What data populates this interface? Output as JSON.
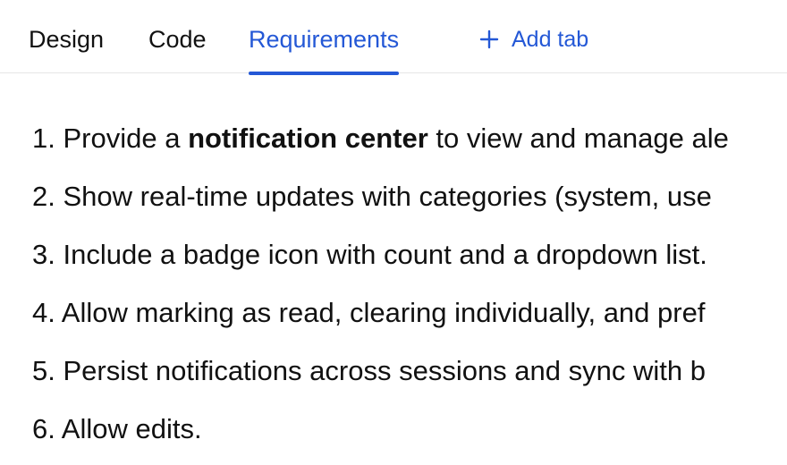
{
  "tabs": [
    {
      "label": "Design",
      "active": false
    },
    {
      "label": "Code",
      "active": false
    },
    {
      "label": "Requirements",
      "active": true
    }
  ],
  "add_tab_label": "Add tab",
  "accent_color": "#2458d6",
  "requirements": [
    {
      "number": "1.",
      "before": "Provide a ",
      "bold": "notification center",
      "after": " to view and manage ale"
    },
    {
      "number": "2.",
      "text": "Show real-time updates with categories (system, use"
    },
    {
      "number": "3.",
      "text": "Include a badge icon with count and a dropdown list."
    },
    {
      "number": "4.",
      "text": "Allow marking as read, clearing individually, and pref"
    },
    {
      "number": "5.",
      "text": "Persist notifications across sessions and sync with b"
    },
    {
      "number": "6.",
      "text": "Allow edits."
    }
  ]
}
